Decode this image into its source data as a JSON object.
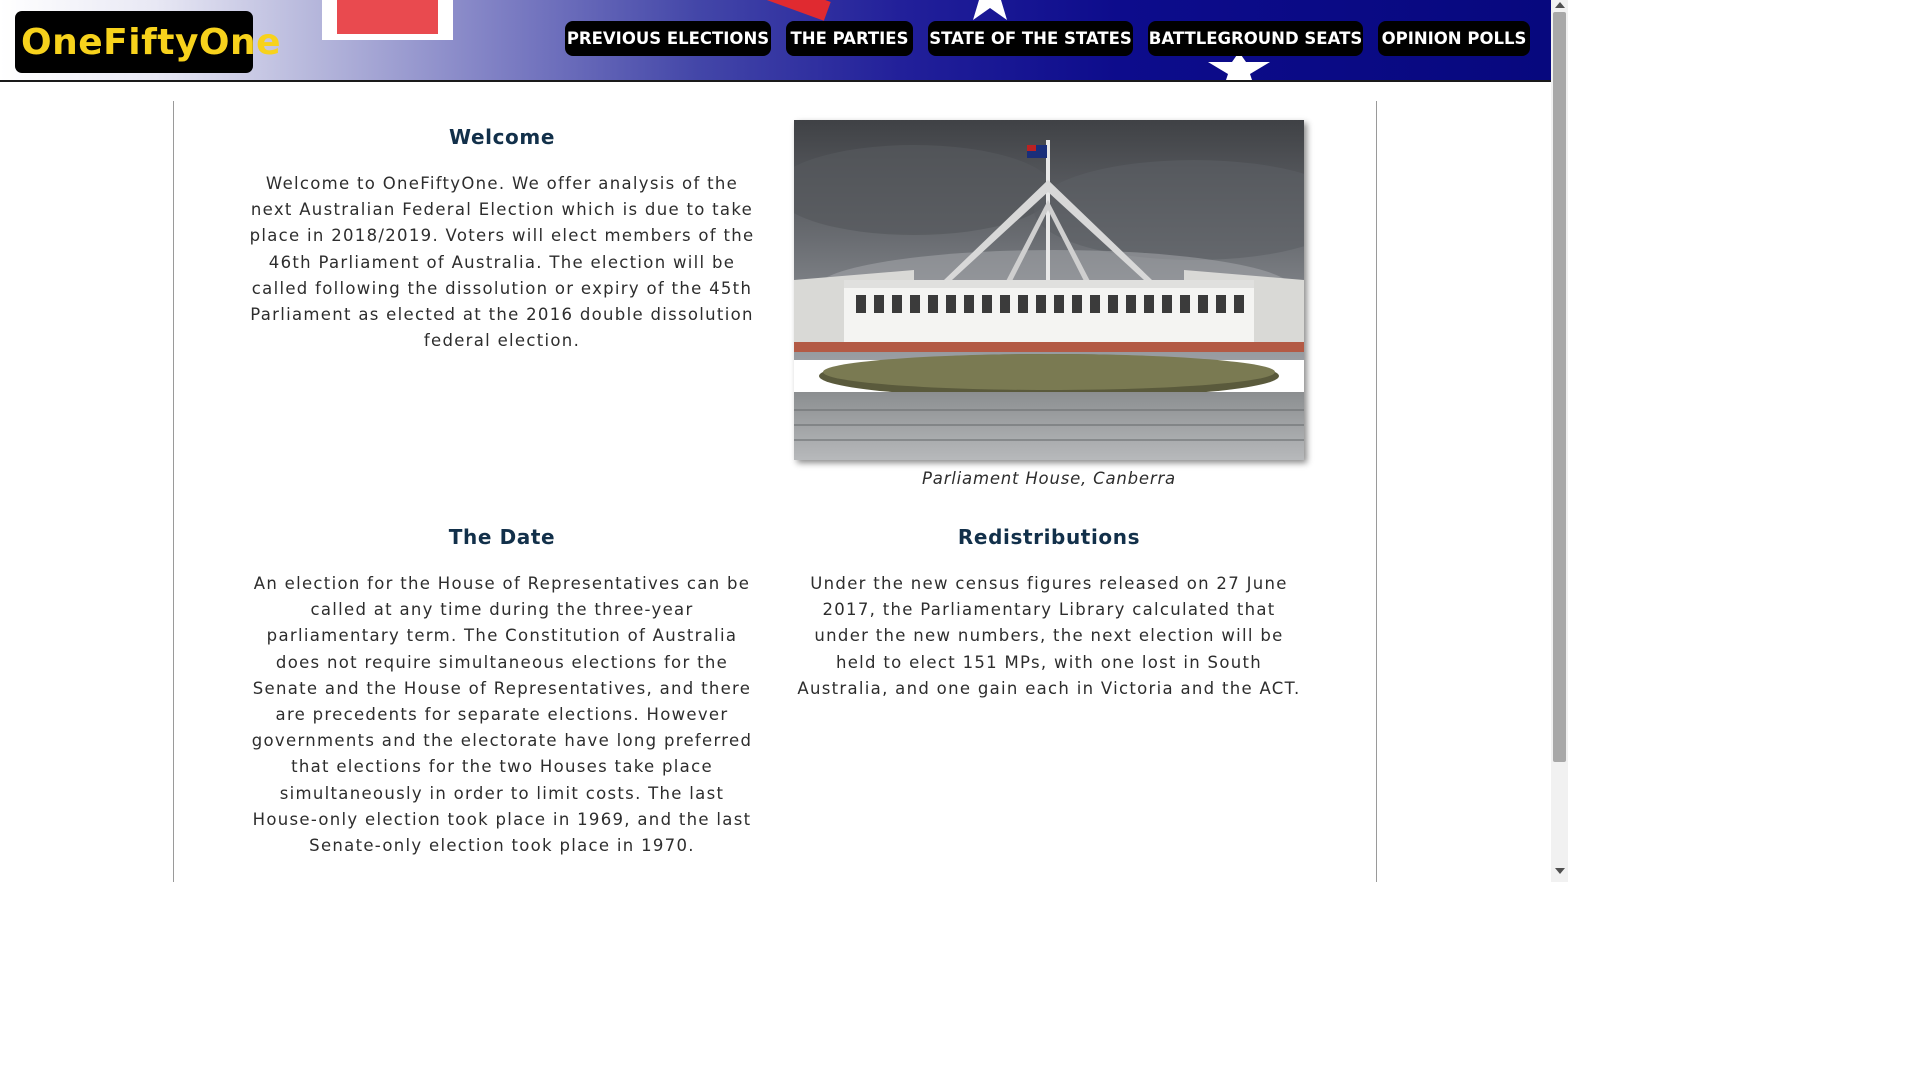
{
  "site": {
    "logo_text": "OneFiftyOne"
  },
  "nav": {
    "items": [
      {
        "label": "PREVIOUS ELECTIONS"
      },
      {
        "label": "THE PARTIES"
      },
      {
        "label": "STATE OF THE STATES"
      },
      {
        "label": "BATTLEGROUND SEATS"
      },
      {
        "label": "OPINION POLLS"
      }
    ]
  },
  "welcome": {
    "title": "Welcome",
    "text": "Welcome to OneFiftyOne. We offer analysis of the next Australian Federal Election which is due to take place in 2018/2019. Voters will elect members of the 46th Parliament of Australia. The election will be called following the dissolution or expiry of the 45th Parliament as elected at the 2016 double dissolution federal election."
  },
  "photo": {
    "caption": "Parliament House, Canberra"
  },
  "date_section": {
    "title": "The Date",
    "text": "An election for the House of Representatives can be called at any time during the three-year parliamentary term. The Constitution of Australia does not require simultaneous elections for the Senate and the House of Representatives, and there are precedents for separate elections. However governments and the electorate have long preferred that elections for the two Houses take place simultaneously in order to limit costs. The last House-only election took place in 1969, and the last Senate-only election took place in 1970."
  },
  "redistributions": {
    "title": "Redistributions",
    "text": "Under the new census figures released on 27 June 2017, the Parliamentary Library calculated that under the new numbers, the next election will be held to elect 151 MPs, with one lost in South Australia, and one gain each in Victoria and the ACT."
  }
}
